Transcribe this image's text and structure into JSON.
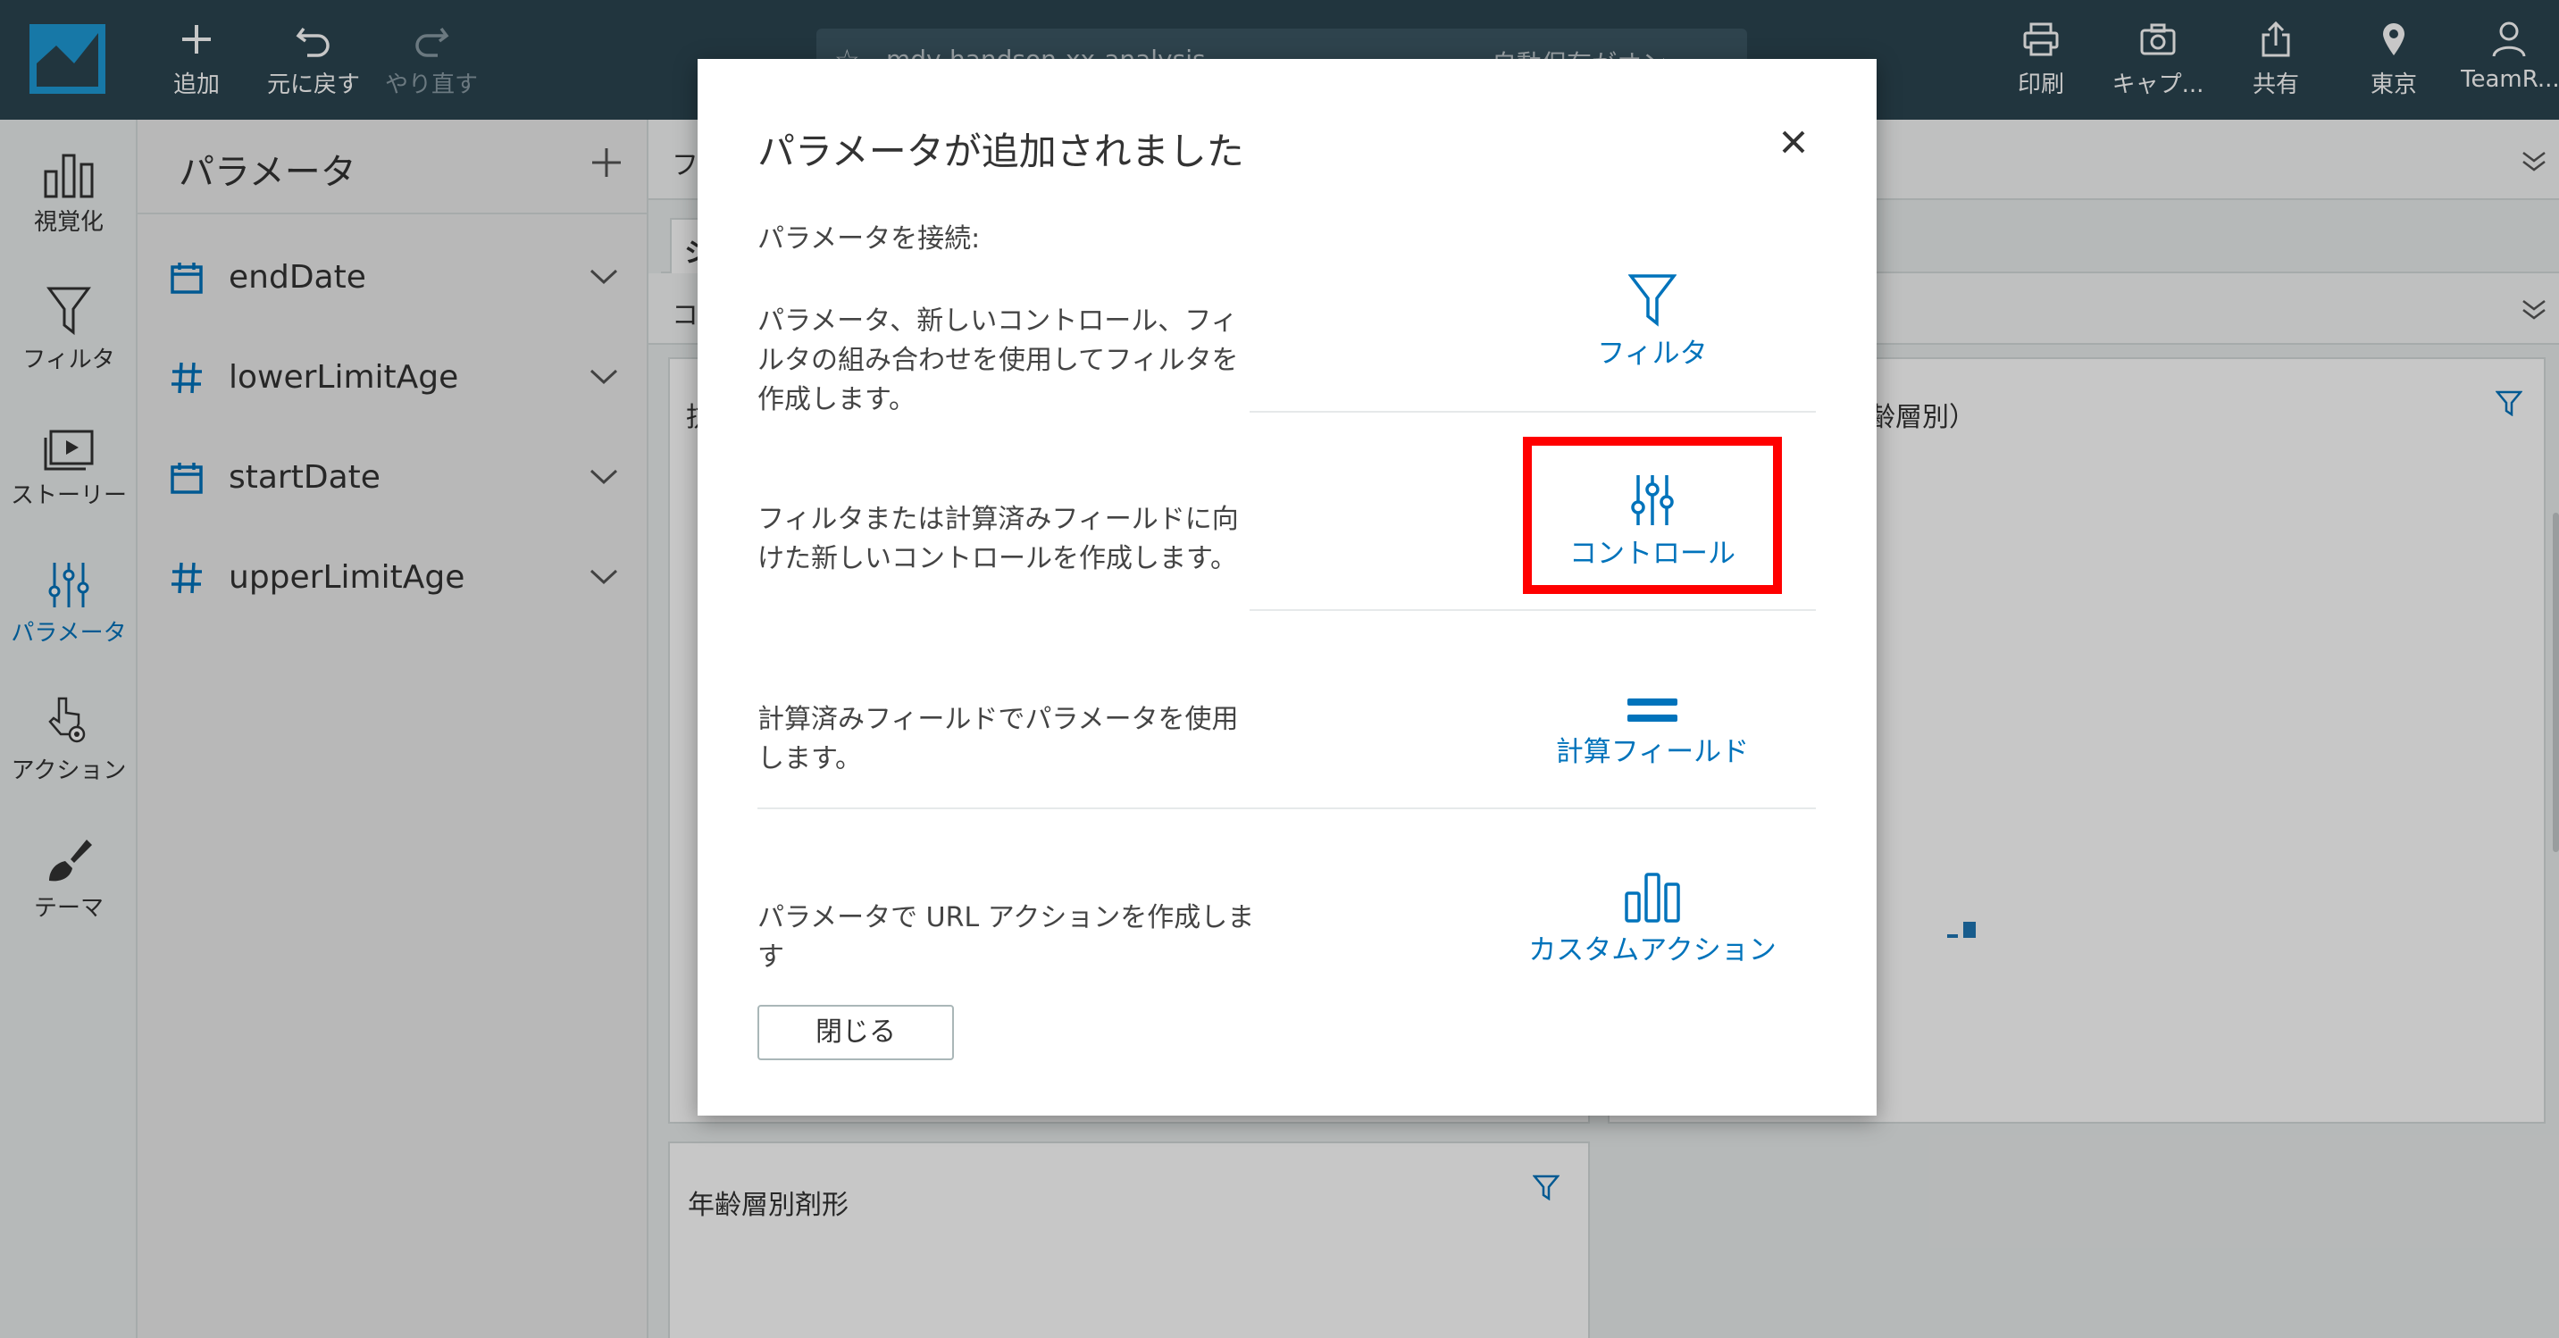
{
  "topbar": {
    "add_label": "追加",
    "undo_label": "元に戻す",
    "redo_label": "やり直す",
    "analysis_name": "mdv-handson-xx-analysis",
    "autosave_label": "自動保存がオン ⌄",
    "print_label": "印刷",
    "capture_label": "キャプ...",
    "share_label": "共有",
    "region_label": "東京",
    "user_label": "TeamR..."
  },
  "rail": {
    "items": [
      {
        "label": "視覚化",
        "icon": "bar-chart-icon"
      },
      {
        "label": "フィルタ",
        "icon": "filter-icon"
      },
      {
        "label": "ストーリー",
        "icon": "story-icon"
      },
      {
        "label": "パラメータ",
        "icon": "sliders-icon",
        "active": true
      },
      {
        "label": "アクション",
        "icon": "pointer-gear-icon"
      },
      {
        "label": "テーマ",
        "icon": "brush-icon"
      }
    ]
  },
  "parameters": {
    "title": "パラメータ",
    "items": [
      {
        "name": "endDate",
        "type": "date"
      },
      {
        "name": "lowerLimitAge",
        "type": "number"
      },
      {
        "name": "startDate",
        "type": "date"
      },
      {
        "name": "upperLimitAge",
        "type": "number"
      }
    ]
  },
  "main": {
    "strip_letter_1": "フ",
    "strip_letter_2": "シ",
    "strip_letter_3": "コ",
    "card_left_letter": "抗",
    "card_right_title": "の処方トレンド（年齢層別）",
    "card_bottom_title": "年齢層別剤形"
  },
  "modal": {
    "title": "パラメータが追加されました",
    "intro": "パラメータを接続:",
    "options": [
      {
        "description": "パラメータ、新しいコントロール、フィルタの組み合わせを使用してフィルタを作成します。",
        "link": "フィルタ",
        "icon": "filter-icon"
      },
      {
        "description": "フィルタまたは計算済みフィールドに向けた新しいコントロールを作成します。",
        "link": "コントロール",
        "icon": "sliders-icon",
        "highlighted": true
      },
      {
        "description": "計算済みフィールドでパラメータを使用します。",
        "link": "計算フィールド",
        "icon": "equals-icon"
      },
      {
        "description": "パラメータで URL アクションを作成します",
        "link": "カスタムアクション",
        "icon": "bar-chart-icon"
      }
    ],
    "close_label": "閉じる"
  },
  "colors": {
    "topbar": "#2b4450",
    "accent": "#0073bb",
    "highlight": "#ff0000"
  }
}
